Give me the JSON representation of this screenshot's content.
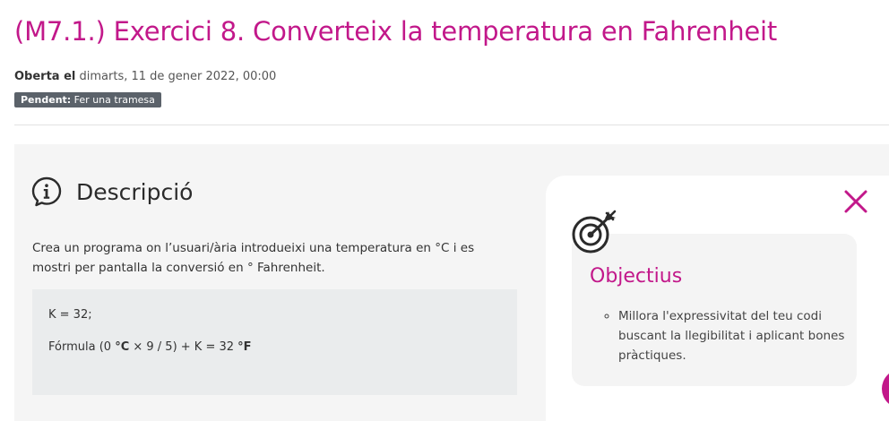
{
  "page": {
    "title": "(M7.1.) Exercici 8. Converteix la temperatura en Fahrenheit",
    "opened_label": "Oberta el",
    "opened_date": " dimarts, 11 de gener 2022, 00:00",
    "status_label": "Pendent:",
    "status_value": " Fer una tramesa"
  },
  "description": {
    "heading": "Descripció",
    "icon": "info-icon",
    "text": "Crea un programa on l’usuari/ària introdueixi una temperatura en °C i es mostri per pantalla la conversió en ° Fahrenheit.",
    "code_line1": "K = 32;",
    "formula_prefix": "Fórmula (0 ",
    "formula_c": "°C",
    "formula_mid": " × 9 / 5) + K = 32 ",
    "formula_f": "°F"
  },
  "objectives": {
    "title": "Objectius",
    "icon": "target-icon",
    "close_icon": "close-icon",
    "items": [
      "Millora l'expressivitat del teu codi buscant la llegibilitat i aplicant bones pràctiques."
    ]
  },
  "colors": {
    "accent": "#c2188a",
    "badge": "#5b626a"
  }
}
